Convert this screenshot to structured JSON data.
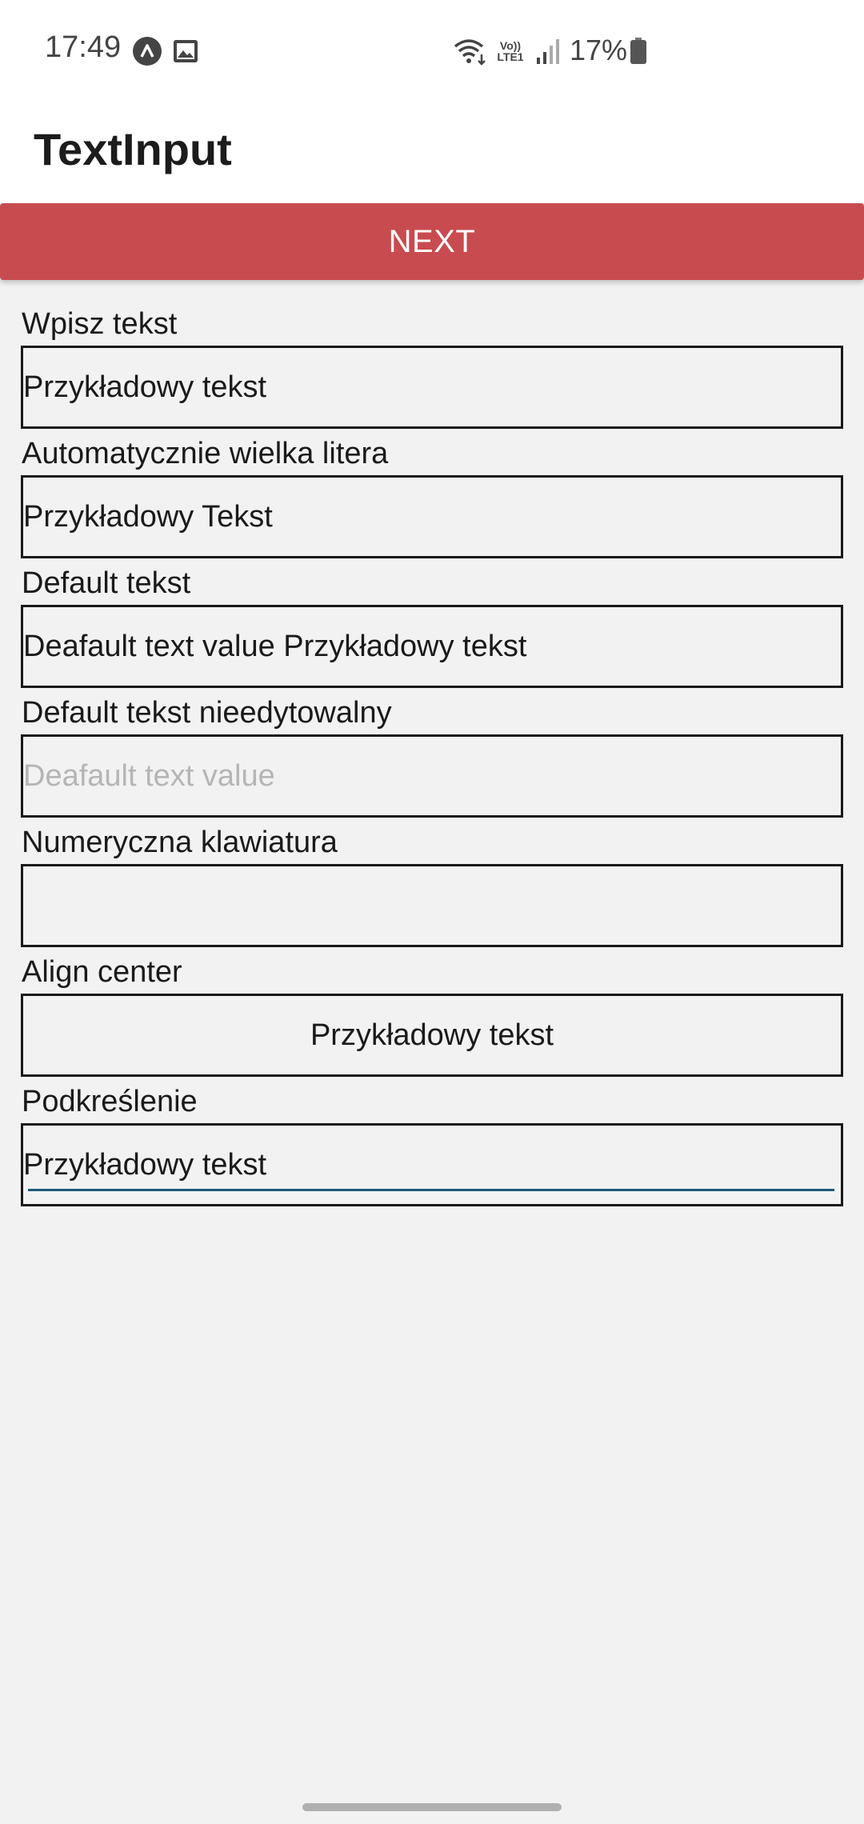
{
  "status_bar": {
    "time": "17:49",
    "icons_left": [
      "app-notification-icon",
      "image-icon"
    ],
    "icons_right": [
      "wifi-icon",
      "volte-lte-icon",
      "signal-icon",
      "battery-icon"
    ],
    "volte_label": "Vo))",
    "lte_label": "LTE1",
    "battery": "17%"
  },
  "header": {
    "title": "TextInput"
  },
  "next_button": {
    "label": "NEXT",
    "color": "#c84b4f"
  },
  "fields": [
    {
      "label": "Wpisz tekst",
      "value": "Przykładowy tekst"
    },
    {
      "label": "Automatycznie wielka litera",
      "value": "Przykładowy Tekst"
    },
    {
      "label": "Default tekst",
      "value": "Deafault text value Przykładowy tekst"
    },
    {
      "label": "Default tekst nieedytowalny",
      "value": "Deafault text value"
    },
    {
      "label": "Numeryczna klawiatura",
      "value": ""
    },
    {
      "label": "Align center",
      "value": "Przykładowy tekst"
    },
    {
      "label": "Podkreślenie",
      "value": "Przykładowy tekst"
    }
  ]
}
